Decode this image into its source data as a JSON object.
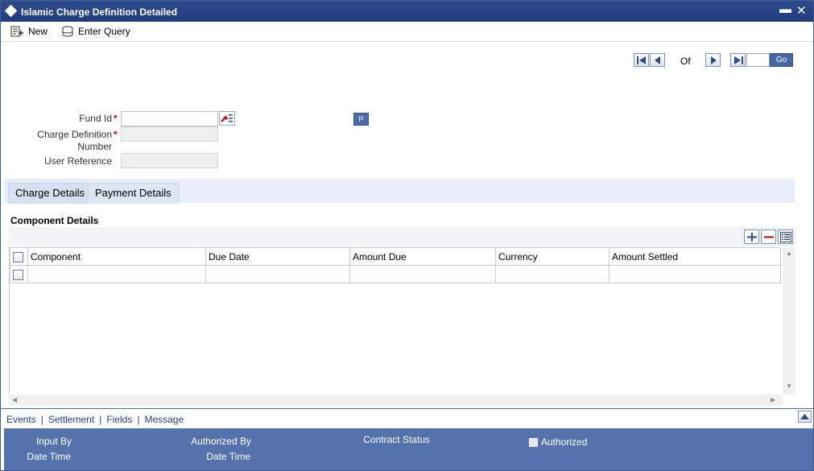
{
  "window": {
    "title": "Islamic Charge Definition Detailed"
  },
  "toolbar": {
    "new_label": "New",
    "enter_query_label": "Enter Query"
  },
  "navigation": {
    "of_label": "Of",
    "go_label": "Go"
  },
  "form": {
    "fund_id_label": "Fund Id",
    "charge_def_label_line1": "Charge Definition",
    "charge_def_label_line2": "Number",
    "user_ref_label": "User Reference",
    "required_mark": "*",
    "p_button_label": "P"
  },
  "tabs": [
    {
      "label": "Charge Details"
    },
    {
      "label": "Payment Details"
    }
  ],
  "section": {
    "title": "Component Details"
  },
  "grid": {
    "columns": [
      "Component",
      "Due Date",
      "Amount Due",
      "Currency",
      "Amount Settled"
    ]
  },
  "links": [
    "Events",
    "Settlement",
    "Fields",
    "Message"
  ],
  "footer": {
    "input_by": "Input By",
    "date_time_1": "Date Time",
    "authorized_by": "Authorized By",
    "date_time_2": "Date Time",
    "contract_status": "Contract Status",
    "authorized": "Authorized"
  },
  "colors": {
    "title_bar": "#1f3d7e",
    "footer": "#5473ad",
    "accent": "#4767a3"
  }
}
